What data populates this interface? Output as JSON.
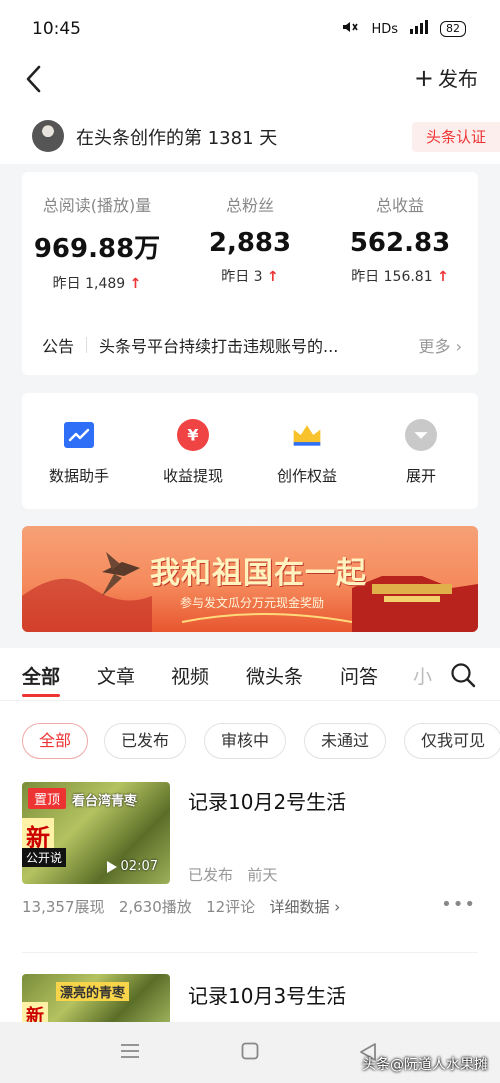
{
  "status_bar": {
    "time": "10:45",
    "network": "HDs",
    "signal": "4G",
    "battery": "82"
  },
  "nav": {
    "back_icon": "chevron-left-icon",
    "publish_label": "发布",
    "publish_icon": "plus-icon"
  },
  "profile": {
    "title": "在头条创作的第 1381 天",
    "badge": "头条认证"
  },
  "stats": [
    {
      "label": "总阅读(播放)量",
      "value": "969.88万",
      "sub": "昨日 1,489"
    },
    {
      "label": "总粉丝",
      "value": "2,883",
      "sub": "昨日 3"
    },
    {
      "label": "总收益",
      "value": "562.83",
      "sub": "昨日 156.81"
    }
  ],
  "notice": {
    "label": "公告",
    "text": "头条号平台持续打击违规账号的...",
    "more": "更多"
  },
  "tools": [
    {
      "label": "数据助手",
      "icon": "trend-chart-icon",
      "color": "#2f6ef6"
    },
    {
      "label": "收益提现",
      "icon": "yuan-icon",
      "color": "#f04343"
    },
    {
      "label": "创作权益",
      "icon": "crown-icon",
      "color": "#f7c22b"
    },
    {
      "label": "展开",
      "icon": "chevron-down-circle-icon",
      "color": "#c9c9c9"
    }
  ],
  "banner": {
    "title": "我和祖国在一起",
    "subtitle": "参与发文瓜分万元现金奖励"
  },
  "tabs": {
    "items": [
      "全部",
      "文章",
      "视频",
      "微头条",
      "问答",
      "小"
    ],
    "active": 0
  },
  "filters": {
    "items": [
      "全部",
      "已发布",
      "审核中",
      "未通过",
      "仅我可见"
    ],
    "active": 0
  },
  "posts": [
    {
      "title": "记录10月2号生活",
      "badge": "置顶",
      "thumb_caption": "看台湾青枣",
      "thumb_label_1": "新",
      "thumb_label_2": "公开说",
      "duration": "02:07",
      "status": "已发布",
      "time": "前天",
      "views": "13,357展现",
      "plays": "2,630播放",
      "comments": "12评论",
      "detail": "详细数据"
    },
    {
      "title": "记录10月3号生活",
      "thumb_caption": "漂亮的青枣",
      "thumb_label_1": "新"
    }
  ],
  "watermark": "头条@阮道人水果摊"
}
